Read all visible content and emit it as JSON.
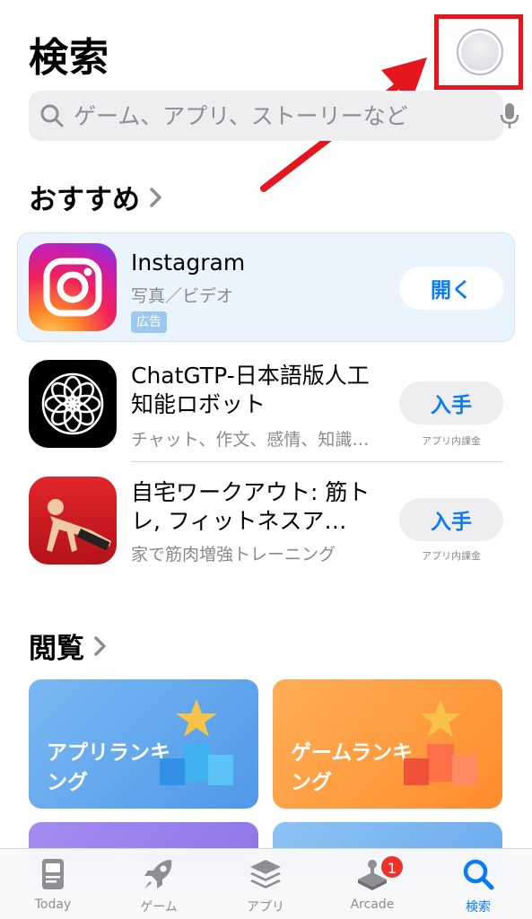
{
  "header": {
    "title": "検索"
  },
  "search": {
    "placeholder": "ゲーム、アプリ、ストーリーなど"
  },
  "sections": {
    "recommended": "おすすめ",
    "browse": "閲覧"
  },
  "apps": [
    {
      "name": "Instagram",
      "subtitle": "写真／ビデオ",
      "badge": "広告",
      "action": "開く",
      "icon": "instagram-icon"
    },
    {
      "name": "ChatGTP-日本語版人工知能ロボット",
      "subtitle": "チャット、作文、感情、知識…",
      "action": "入手",
      "note": "アプリ内課金",
      "icon": "flower-pattern-icon"
    },
    {
      "name": "自宅ワークアウト: 筋トレ, フィットネスア…",
      "subtitle": "家で筋肉増強トレーニング",
      "action": "入手",
      "note": "アプリ内課金",
      "icon": "pushup-icon"
    }
  ],
  "browse_tiles": [
    {
      "label": "アプリランキング",
      "color": "#5ea7ee"
    },
    {
      "label": "ゲームランキング",
      "color": "#ff9a3c"
    }
  ],
  "tabs": [
    {
      "label": "Today",
      "icon": "today-icon"
    },
    {
      "label": "ゲーム",
      "icon": "rocket-icon"
    },
    {
      "label": "アプリ",
      "icon": "stack-icon"
    },
    {
      "label": "Arcade",
      "icon": "joystick-icon",
      "badge": "1"
    },
    {
      "label": "検索",
      "icon": "search-icon",
      "active": true
    }
  ],
  "colors": {
    "accent": "#0a7bf5",
    "annotation": "#e5161d"
  }
}
